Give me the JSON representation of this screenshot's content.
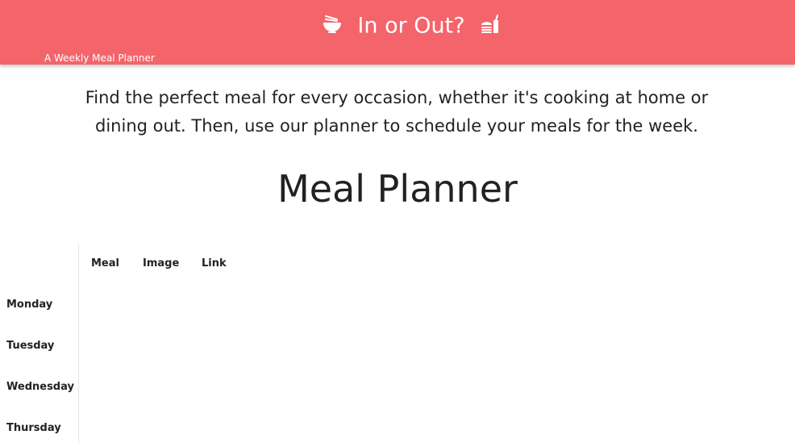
{
  "header": {
    "title": "In or Out?",
    "subtitle": "A Weekly Meal Planner",
    "left_icon": "ramen-bowl-icon",
    "right_icon": "burger-drink-icon",
    "background_color": "#f4646b"
  },
  "intro_text": "Find the perfect meal for every occasion, whether it's cooking at home or dining out. Then, use our planner to schedule your meals for the week.",
  "planner": {
    "title": "Meal Planner",
    "columns": [
      "Meal",
      "Image",
      "Link"
    ],
    "days": [
      "Monday",
      "Tuesday",
      "Wednesday",
      "Thursday"
    ]
  }
}
